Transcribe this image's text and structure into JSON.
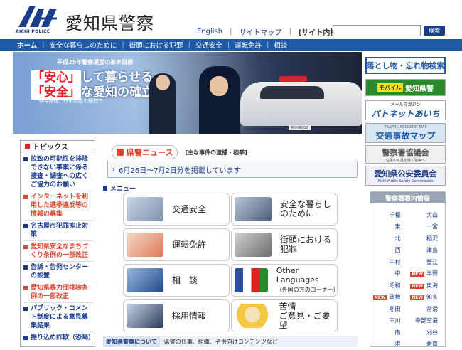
{
  "header": {
    "logo_sub": "AICHI POLICE",
    "site_title": "愛知県警察",
    "links": [
      "English",
      "サイトマップ"
    ],
    "site_search_label": "[サイト内検索]",
    "search_placeholder": "",
    "search_button": "検索"
  },
  "nav": {
    "items": [
      "ホーム",
      "安全な暮らしのために",
      "街頭における犯罪",
      "交通安全",
      "運転免許",
      "相談"
    ]
  },
  "hero": {
    "goal": "平成25年警察運営の基本目標",
    "slogan_line1_hl": "「安心」",
    "slogan_line1_rest": "して暮らせる",
    "slogan_line2_hl": "「安全」",
    "slogan_line2_rest": "な愛知の確立",
    "note": "常時警戒、有事即応の態勢で",
    "plate": "名古屋800"
  },
  "banners": {
    "lost": "落とし物・忘れ物検索",
    "mobile_tag": "モバイル",
    "mobile": "愛知県警",
    "mail_small": "メールマガジン",
    "mail": "パトネットあいち",
    "traffic_small": "TRAFFIC ACCIDENT MAP",
    "traffic": "交通事故マップ",
    "assoc": "警察署協議会",
    "assoc_small": "住民の意見を聞く警察へ",
    "public": "愛知県公安委員会",
    "public_small": "Aichi Public Safety Commission"
  },
  "topics": {
    "title": "トピックス",
    "items": [
      {
        "text": "拉致の可能性を排除\nできない事案に係る\n捜査・調査への広く\nご協力のお願い",
        "color": "blue"
      },
      {
        "text": "インターネットを利\n用した選挙違反等の\n情報の募集",
        "color": "red"
      },
      {
        "text": "名古屋市犯罪抑止対\n策",
        "color": "blue"
      },
      {
        "text": "愛知県安全なまちづ\nくり条例の一部改正",
        "color": "red"
      },
      {
        "text": "告訴・告発センター\nの設置",
        "color": "blue"
      },
      {
        "text": "愛知県暴力団排除条\n例の一部改正",
        "color": "red"
      },
      {
        "text": "パブリック・コメン\nト制度による意見募\n集結果",
        "color": "blue"
      },
      {
        "text": "振り込め詐欺（恐喝）",
        "color": "blue"
      }
    ]
  },
  "news": {
    "title": "県警ニュース",
    "subtitle": "[主な事件の逮捕・検挙]",
    "item": "6月26日～7月2日分を掲載しています"
  },
  "menu": {
    "title": "メニュー",
    "items": {
      "traffic": "交通安全",
      "safe": "安全な暮らし\nのために",
      "license": "運転免許",
      "crime": "街頭における\n犯罪",
      "consult": "相　談",
      "lang": "Other Languages",
      "lang_sub": "（外国の方のコーナー）",
      "recruit": "採用情報",
      "complaint": "苦情\nご意見・ご要望"
    }
  },
  "about": {
    "label": "愛知県警察について",
    "text": "県警の仕事、組織、子供向けコンテンツなど"
  },
  "stations": {
    "title": "警察署署内情報",
    "rows": [
      [
        "千種",
        "犬山"
      ],
      [
        "東",
        "一宮"
      ],
      [
        "北",
        "稲沢"
      ],
      [
        "西",
        "津島"
      ],
      [
        "中村",
        "蟹江"
      ],
      [
        "中",
        "半田"
      ],
      [
        "昭和",
        "東海"
      ],
      [
        "瑞穂",
        "知多"
      ],
      [
        "熱田",
        "常滑"
      ],
      [
        "中川",
        "中部空港"
      ],
      [
        "南",
        "刈谷"
      ],
      [
        "港",
        "碧南"
      ]
    ],
    "new_label": "NEW"
  },
  "colors": {
    "nav": "#1f5aa6",
    "accent_red": "#e0452b",
    "brand_blue": "#1a3c8c"
  }
}
